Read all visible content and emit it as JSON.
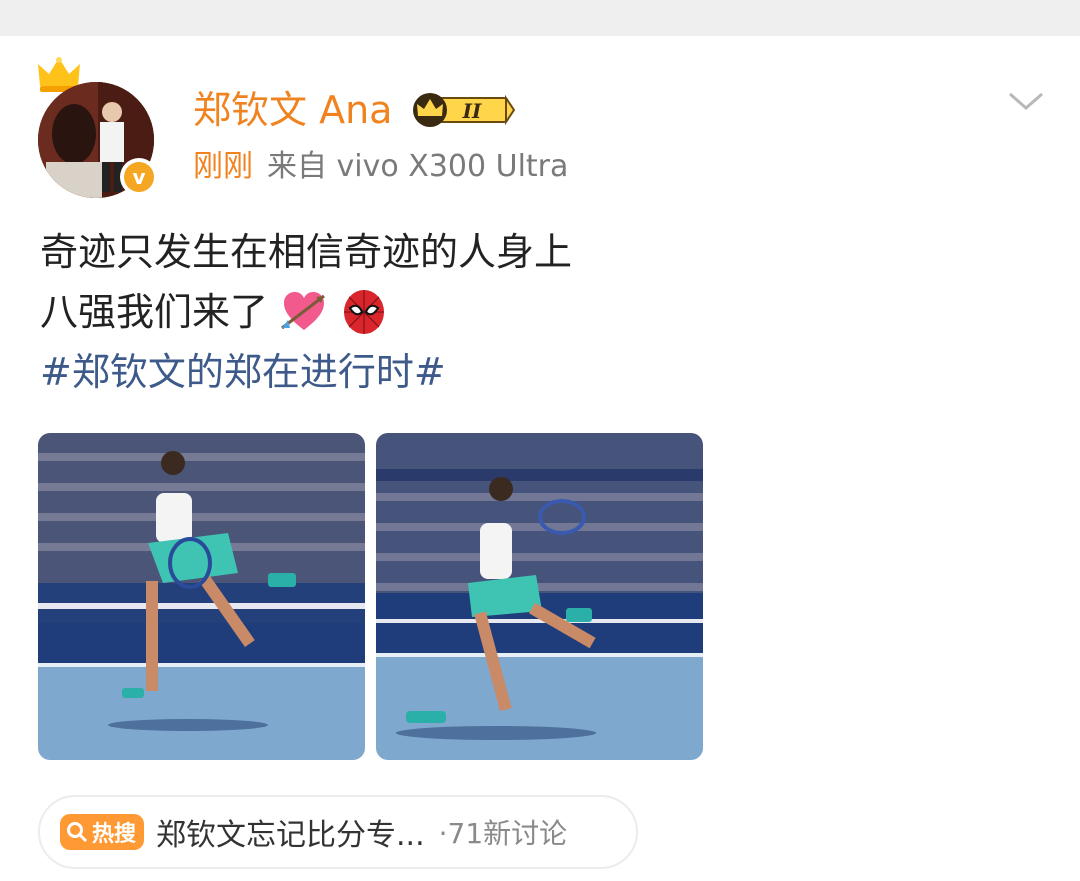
{
  "post": {
    "author": {
      "name": "郑钦文 Ana",
      "member_level": "II",
      "avatar_icon": "avatar-photo",
      "verified_icon": "verified-badge-icon",
      "crown_icon": "crown-icon",
      "verified_glyph": "v"
    },
    "time": "刚刚",
    "source": "来自 vivo X300 Ultra",
    "text_line1": "奇迹只发生在相信奇迹的人身上",
    "text_line2": "八强我们来了",
    "emojis": [
      "heart-with-arrow-emoji",
      "spiderman-emoji"
    ],
    "hashtag": "#郑钦文的郑在进行时#",
    "images": [
      {
        "name": "tennis-photo-1",
        "alt": "tennis player forehand photo"
      },
      {
        "name": "tennis-photo-2",
        "alt": "tennis player running photo"
      }
    ],
    "hot_search": {
      "badge": "热搜",
      "title": "郑钦文忘记比分专...",
      "count": "·71新讨论"
    }
  },
  "colors": {
    "orange": "#f08320",
    "hashtag_blue": "#3d5a8a",
    "court_blue": "#2a5aa8",
    "hot_badge": "#ff9933"
  }
}
